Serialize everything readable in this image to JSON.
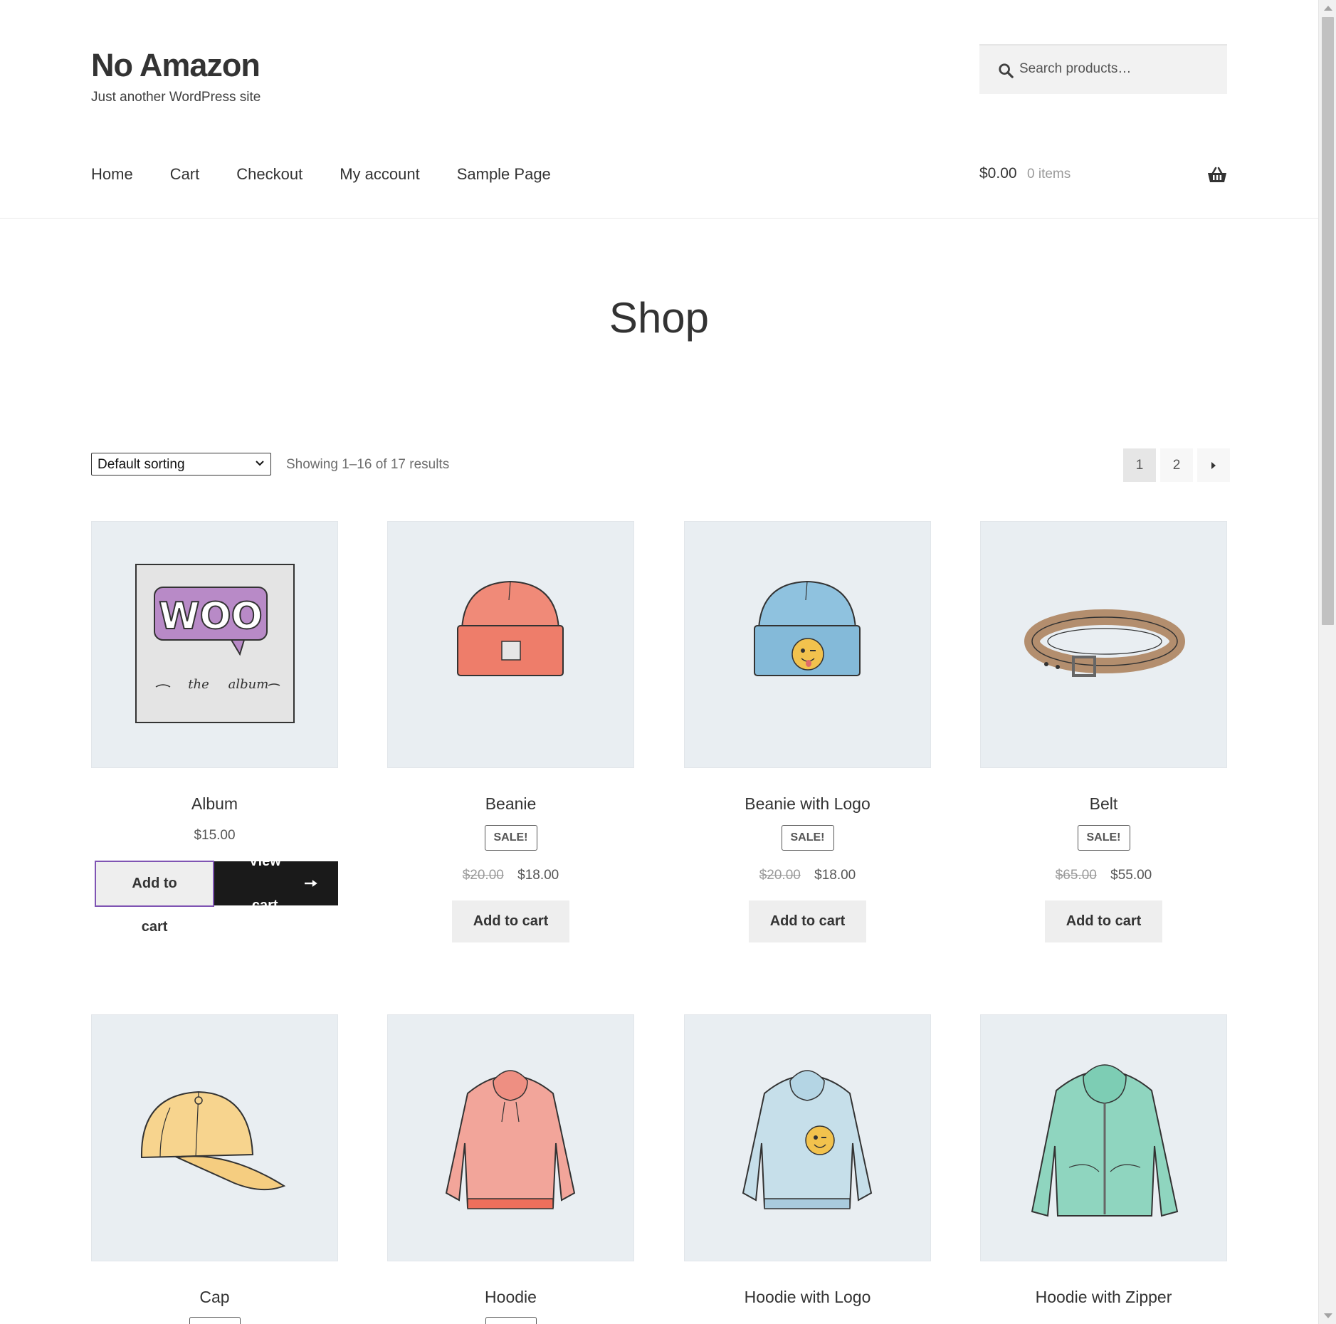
{
  "site": {
    "title": "No Amazon",
    "tagline": "Just another WordPress site"
  },
  "search": {
    "placeholder": "Search products…"
  },
  "nav": {
    "items": [
      "Home",
      "Cart",
      "Checkout",
      "My account",
      "Sample Page"
    ]
  },
  "cart": {
    "amount": "$0.00",
    "count": "0 items"
  },
  "page": {
    "title": "Shop"
  },
  "toolbar": {
    "sorting_selected": "Default sorting",
    "result_count": "Showing 1–16 of 17 results"
  },
  "pagination": {
    "pages": [
      "1",
      "2"
    ],
    "current": "1"
  },
  "products": [
    {
      "name": "Album",
      "price": "$15.00",
      "add_to_cart": "Add to cart",
      "view_cart": "View cart"
    },
    {
      "name": "Beanie",
      "badge": "SALE!",
      "regular_price": "$20.00",
      "sale_price": "$18.00",
      "add_to_cart": "Add to cart"
    },
    {
      "name": "Beanie with Logo",
      "badge": "SALE!",
      "regular_price": "$20.00",
      "sale_price": "$18.00",
      "add_to_cart": "Add to cart"
    },
    {
      "name": "Belt",
      "badge": "SALE!",
      "regular_price": "$65.00",
      "sale_price": "$55.00",
      "add_to_cart": "Add to cart"
    },
    {
      "name": "Cap"
    },
    {
      "name": "Hoodie"
    },
    {
      "name": "Hoodie with Logo"
    },
    {
      "name": "Hoodie with Zipper"
    }
  ],
  "colors": {
    "accent_outline": "#7f54b3",
    "view_cart_bg": "#1a1a1a",
    "thumb_bg": "#e9eef2",
    "button_bg": "#eeeeee"
  }
}
